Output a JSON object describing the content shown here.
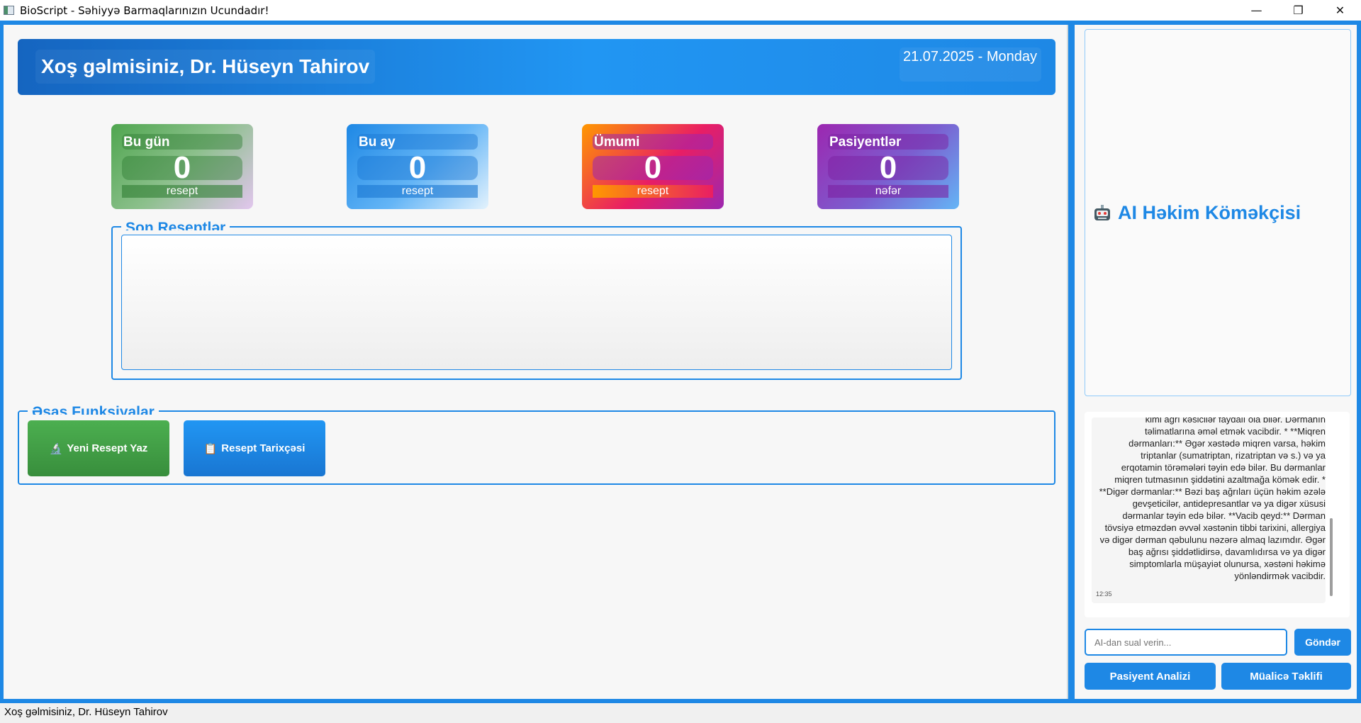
{
  "window": {
    "title": "BioScript - Səhiyyə Barmaqlarınızın Ucundadır!",
    "controls": {
      "minimize": "—",
      "maximize": "❐",
      "close": "✕"
    }
  },
  "header": {
    "welcome": "Xoş gəlmisiniz, Dr. Hüseyn Tahirov",
    "date": "21.07.2025 - Monday"
  },
  "stats": [
    {
      "label": "Bu gün",
      "value": "0",
      "unit": "resept"
    },
    {
      "label": "Bu ay",
      "value": "0",
      "unit": "resept"
    },
    {
      "label": "Ümumi",
      "value": "0",
      "unit": "resept"
    },
    {
      "label": "Pasiyentlər",
      "value": "0",
      "unit": "nəfər"
    }
  ],
  "recent": {
    "title": "Son Reseptlər"
  },
  "functions": {
    "title": "Əsas Funksiyalar",
    "new_prescription": "Yeni Resept Yaz",
    "history": "Resept Tarixçəsi",
    "new_prescription_icon": "🔬",
    "history_icon": "📋"
  },
  "ai": {
    "title": "AI Həkim Köməkçisi",
    "message": "şiddətli baş ağrıları üçün parasetamol və ya ibuprofen kimi ağrı kəsicilər faydalı ola bilər. Dərmanın təlimatlarına əməl etmək vacibdir. * **Miqren dərmanları:** Əgər xəstədə miqren varsa, həkim triptanlar (sumatriptan, rizatriptan və s.) və ya erqotamin törəmələri təyin edə bilər. Bu dərmanlar miqren tutmasının şiddətini azaltmağa kömək edir. * **Digər dərmanlar:** Bəzi baş ağrıları üçün həkim əzələ gevşeticilər, antidepresantlar və ya digər xüsusi dərmanlar təyin edə bilər. **Vacib qeyd:** Dərman tövsiyə etməzdən əvvəl xəstənin tibbi tarixini, allergiya və digər dərman qəbulunu nəzərə almaq lazımdır. Əgər baş ağrısı şiddətlidirsə, davamlıdırsa və ya digər simptomlarla müşayiət olunursa, xəstəni həkimə yönləndirmək vacibdir.",
    "message_time": "12:35",
    "input_placeholder": "AI-dan sual verin...",
    "send": "Göndər",
    "patient_analysis": "Pasiyent Analizi",
    "treatment": "Müalicə Təklifi"
  },
  "status": "Xoş gəlmisiniz, Dr. Hüseyn Tahirov"
}
